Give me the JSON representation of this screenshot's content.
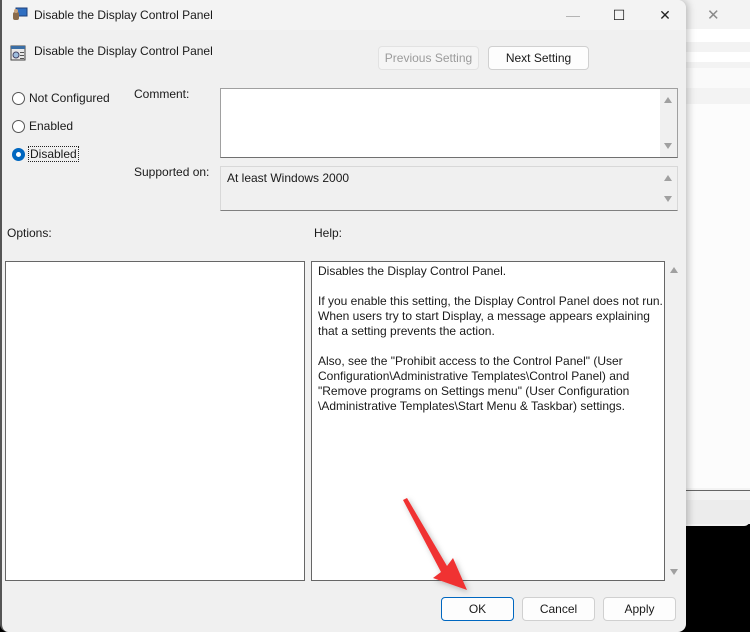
{
  "window": {
    "title": "Disable the Display Control Panel",
    "minimize_glyph": "—",
    "maximize_glyph": "☐",
    "close_glyph": "✕"
  },
  "header": {
    "policy_name": "Disable the Display Control Panel",
    "previous_label": "Previous Setting",
    "next_label": "Next Setting"
  },
  "state": {
    "options": [
      {
        "label": "Not Configured",
        "checked": false
      },
      {
        "label": "Enabled",
        "checked": false
      },
      {
        "label": "Disabled",
        "checked": true
      }
    ]
  },
  "comment": {
    "label": "Comment:",
    "value": ""
  },
  "supported": {
    "label": "Supported on:",
    "value": "At least Windows 2000"
  },
  "options_panel": {
    "label": "Options:"
  },
  "help": {
    "label": "Help:",
    "text": "Disables the Display Control Panel.\n\nIf you enable this setting, the Display Control Panel does not run.\nWhen users try to start Display, a message appears explaining\nthat a setting prevents the action.\n\nAlso, see the \"Prohibit access to the Control Panel\" (User\nConfiguration\\Administrative Templates\\Control Panel) and\n\"Remove programs on Settings menu\" (User Configuration\n\\Administrative Templates\\Start Menu & Taskbar) settings."
  },
  "footer": {
    "ok_label": "OK",
    "cancel_label": "Cancel",
    "apply_label": "Apply"
  },
  "background_window": {
    "close_glyph": "✕"
  },
  "annotation": {
    "color": "#f03030"
  },
  "colors": {
    "accent": "#0067c0"
  }
}
